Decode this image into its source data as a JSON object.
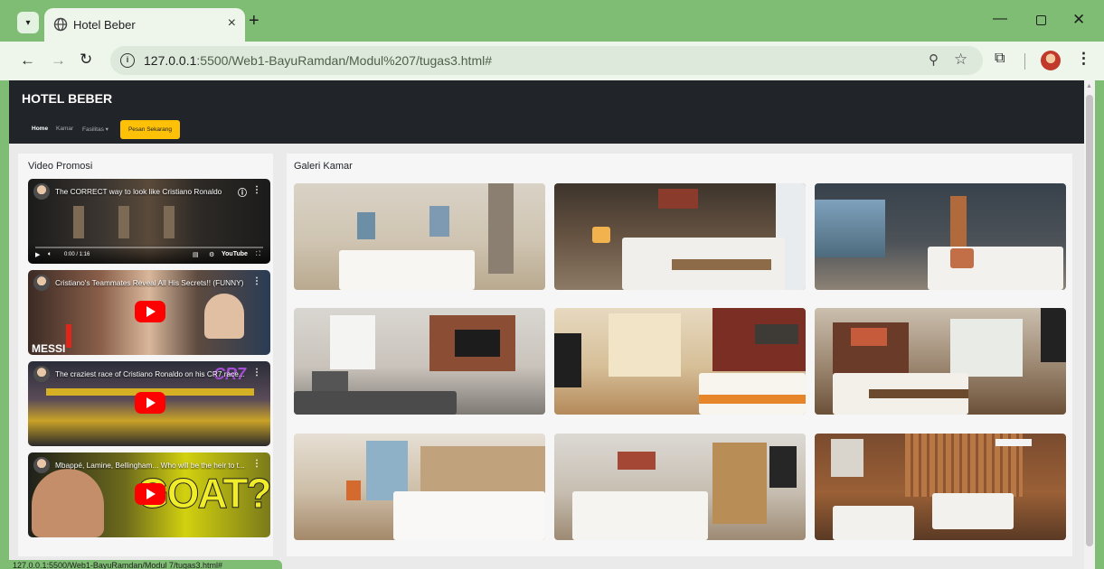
{
  "browser": {
    "tab_title": "Hotel Beber",
    "url_host": "127.0.0.1",
    "url_path": ":5500/Web1-BayuRamdan/Modul%207/tugas3.html#",
    "status_url": "127.0.0.1:5500/Web1-BayuRamdan/Modul 7/tugas3.html#"
  },
  "navbar": {
    "brand": "HOTEL BEBER",
    "links": [
      "Home",
      "Kamar",
      "Fasilitas ▾"
    ],
    "order_button": "Pesan Sekarang"
  },
  "videos": {
    "title": "Video Promosi",
    "items": [
      {
        "title": "The CORRECT way to look like Cristiano Ronaldo",
        "time": "0:00 / 1:16",
        "brand": "YouTube"
      },
      {
        "title": "Cristiano's Teammates Reveal All His Secrets!! (FUNNY)",
        "overlay": "MESSI"
      },
      {
        "title": "The craziest race of Cristiano Ronaldo on his CR7 race...",
        "overlay": "CR7"
      },
      {
        "title": "Mbappé, Lamine, Bellingham... Who will be the heir to t...",
        "overlay": "GOAT?"
      }
    ]
  },
  "gallery": {
    "title": "Galeri Kamar"
  },
  "colors": {
    "chrome": "#7ebd73",
    "navbar": "#212529",
    "accent": "#ffc107",
    "yt_red": "#ff0000"
  }
}
